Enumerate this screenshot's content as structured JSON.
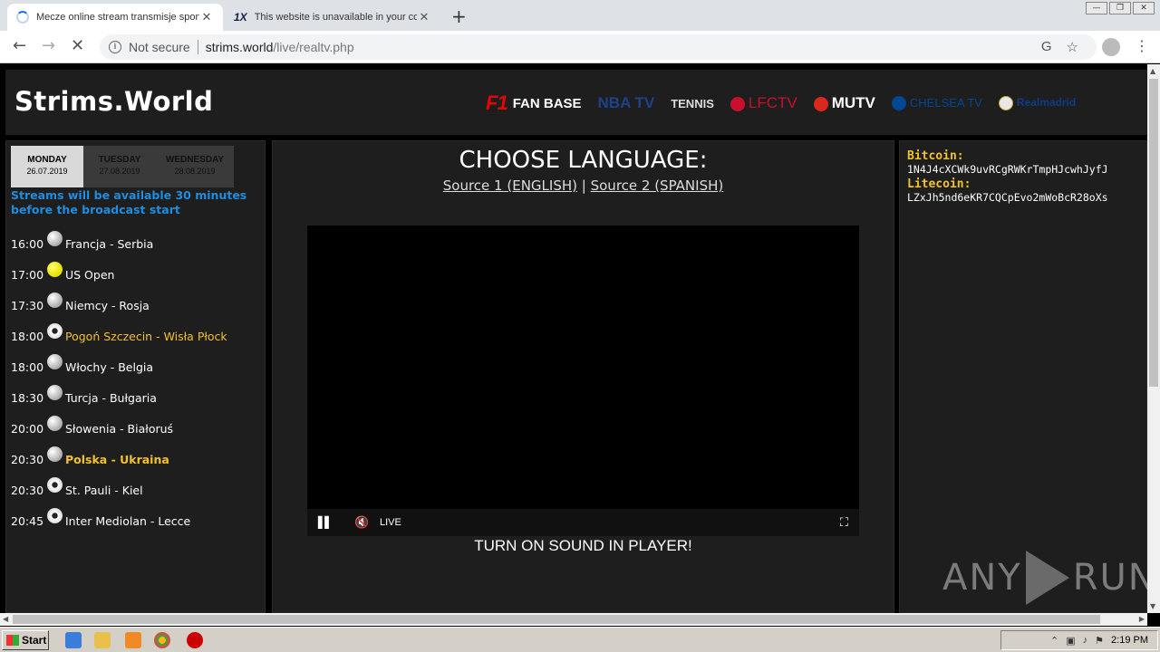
{
  "browser": {
    "tabs": [
      {
        "title": "Mecze online stream transmisje sport",
        "close": "✕"
      },
      {
        "title": "This website is unavailable in your co",
        "close": "✕",
        "logo": "1X"
      }
    ],
    "new_tab": "+",
    "window_controls": {
      "minimize": "—",
      "restore": "❐",
      "close": "✕"
    },
    "nav": {
      "back": "←",
      "forward": "→",
      "reload": "✕"
    },
    "security_label": "Not secure",
    "url_host": "strims.world",
    "url_path": "/live/realtv.php",
    "omnibox_icons": {
      "translate": "G",
      "bookmark": "☆"
    },
    "menu": "⋮"
  },
  "site": {
    "logo": "Strims.World",
    "channels": {
      "f1": "F1",
      "fanbase": "FAN BASE",
      "nba": "NBA TV",
      "tennis": "TENNIS",
      "lfc": "LFCTV",
      "mutv": "MUTV",
      "chelsea": "CHELSEA TV",
      "real": "Realmadrid"
    }
  },
  "left": {
    "days": [
      {
        "name": "MONDAY",
        "date": "26.07.2019"
      },
      {
        "name": "TUESDAY",
        "date": "27.08.2019"
      },
      {
        "name": "WEDNESDAY",
        "date": "28.08.2019"
      }
    ],
    "notice": "Streams will be available 30 minutes before the broadcast start",
    "events": [
      {
        "time": "16:00",
        "name": "Francja - Serbia"
      },
      {
        "time": "17:00",
        "name": "US Open"
      },
      {
        "time": "17:30",
        "name": "Niemcy - Rosja"
      },
      {
        "time": "18:00",
        "name": "Pogoń Szczecin - Wisła Płock"
      },
      {
        "time": "18:00",
        "name": "Włochy - Belgia"
      },
      {
        "time": "18:30",
        "name": "Turcja - Bułgaria"
      },
      {
        "time": "20:00",
        "name": "Słowenia - Białoruś"
      },
      {
        "time": "20:30",
        "name": "Polska - Ukraina"
      },
      {
        "time": "20:30",
        "name": "St. Pauli - Kiel"
      },
      {
        "time": "20:45",
        "name": "Inter Mediolan - Lecce"
      }
    ]
  },
  "center": {
    "title": "CHOOSE LANGUAGE:",
    "source1": "Source 1 (ENGLISH)",
    "divider": "|",
    "source2": "Source 2 (SPANISH)",
    "player": {
      "pause": "▌▌",
      "mute": "🔇",
      "live": "LIVE",
      "fullscreen": "⛶"
    },
    "sound_note": "TURN ON SOUND IN PLAYER!"
  },
  "right": {
    "btc_label": "Bitcoin:",
    "btc_addr": "1N4J4cXCWk9uvRCgRWKrTmpHJcwhJyfJ",
    "ltc_label": "Litecoin:",
    "ltc_addr": "LZxJh5nd6eKR7CQCpEvo2mWoBcR28oXs"
  },
  "watermark": {
    "left": "ANY",
    "right": "RUN"
  },
  "taskbar": {
    "start": "Start",
    "clock": "2:19 PM"
  }
}
